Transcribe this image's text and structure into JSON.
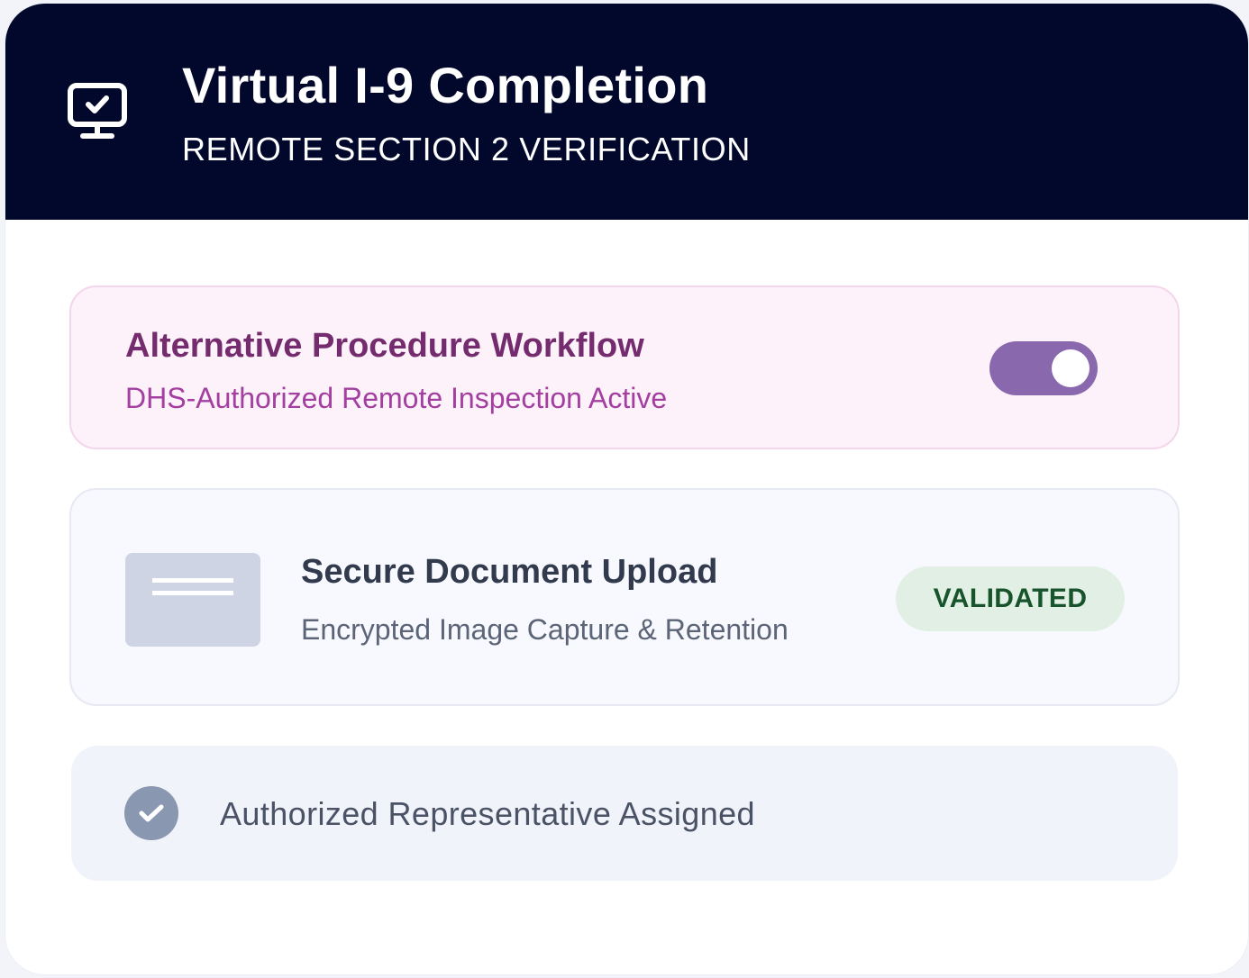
{
  "header": {
    "icon": "monitor-check-icon",
    "title": "Virtual I-9 Completion",
    "subtitle": "REMOTE SECTION 2 VERIFICATION"
  },
  "workflow": {
    "title": "Alternative Procedure Workflow",
    "subtitle": "DHS-Authorized Remote Inspection Active",
    "toggle_on": true,
    "accent_color": "#8a68ae"
  },
  "upload": {
    "icon": "document-icon",
    "title": "Secure Document Upload",
    "subtitle": "Encrypted Image Capture & Retention",
    "status": "VALIDATED",
    "status_color": "#17532b"
  },
  "representative": {
    "icon": "check-circle-icon",
    "label": "Authorized Representative Assigned"
  }
}
